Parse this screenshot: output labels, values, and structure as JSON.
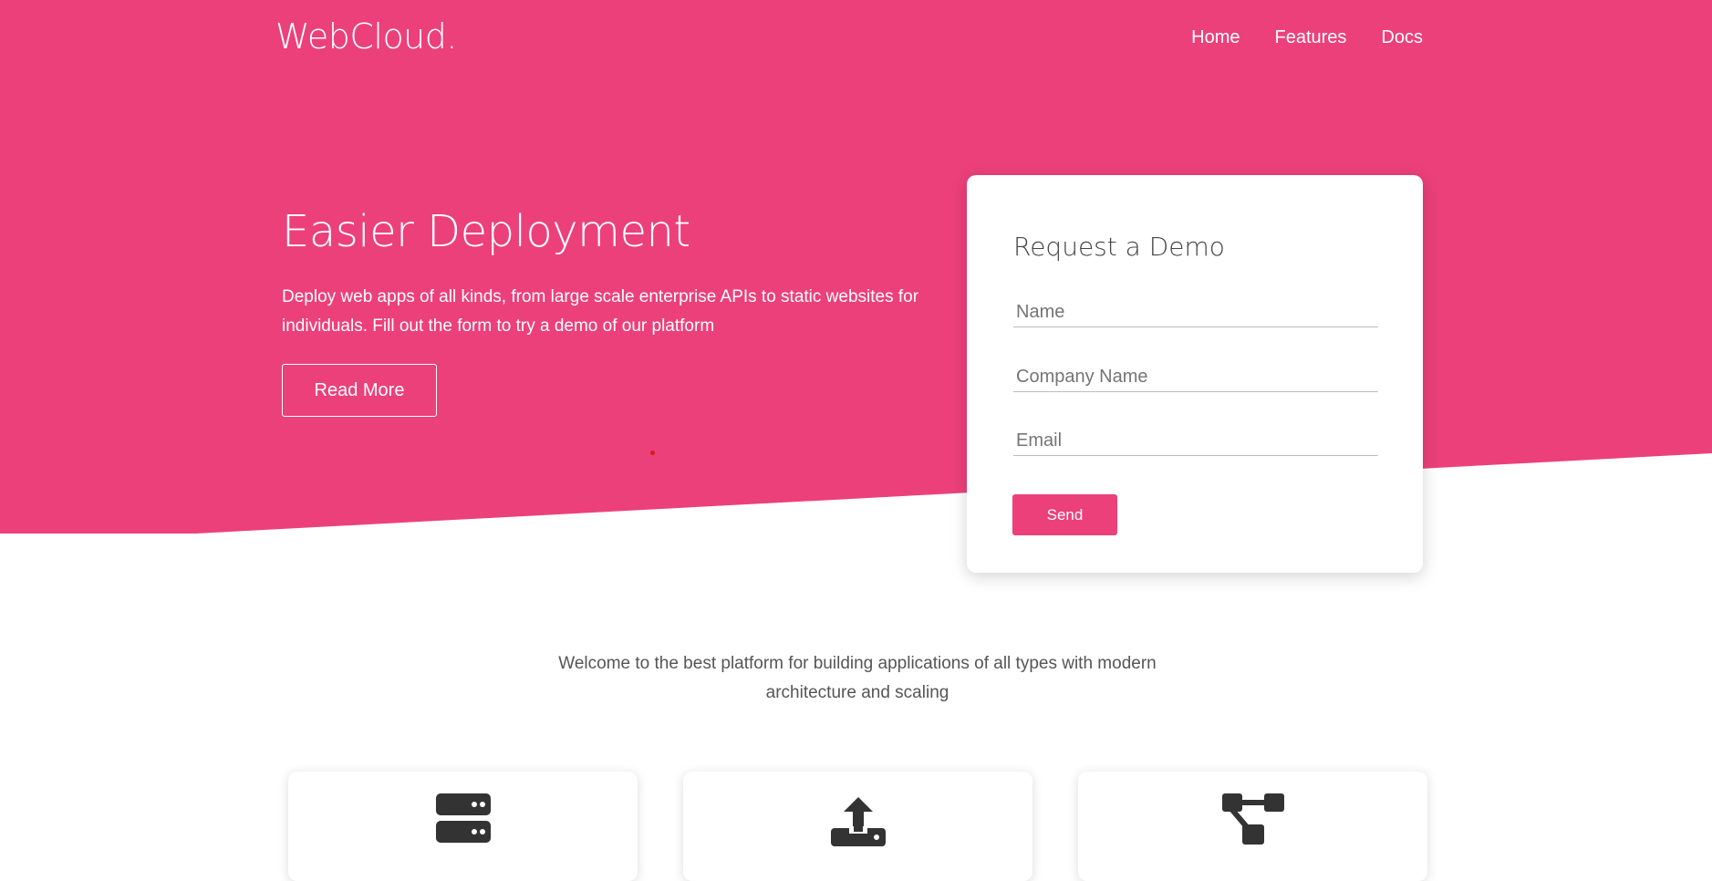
{
  "brand": {
    "logo": "WebCloud."
  },
  "nav": {
    "items": [
      "Home",
      "Features",
      "Docs"
    ]
  },
  "hero": {
    "title": "Easier Deployment",
    "description": "Deploy web apps of all kinds, from large scale enterprise APIs to static websites for individuals. Fill out the form to try a demo of our platform",
    "read_more_label": "Read More"
  },
  "demo_form": {
    "title": "Request a Demo",
    "name_placeholder": "Name",
    "company_placeholder": "Company Name",
    "email_placeholder": "Email",
    "send_label": "Send"
  },
  "welcome": {
    "text": "Welcome to the best platform for building applications of all types with modern architecture and scaling"
  },
  "features": [
    {
      "icon": "server-icon"
    },
    {
      "icon": "upload-icon"
    },
    {
      "icon": "network-icon"
    }
  ],
  "colors": {
    "accent": "#ec407a",
    "icon": "#333333"
  }
}
